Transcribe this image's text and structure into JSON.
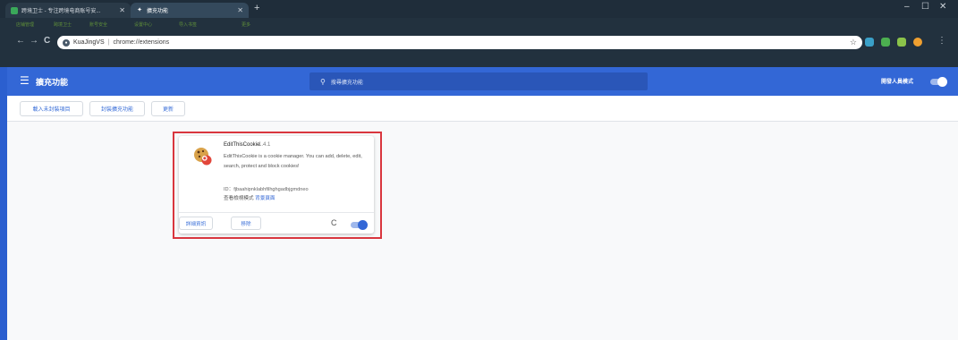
{
  "browser": {
    "tabs": [
      {
        "title": "跨境卫士 - 专注跨境电商账号安...",
        "active": false
      },
      {
        "title": "擴充功能",
        "active": true
      }
    ],
    "new_tab_symbol": "+",
    "window_controls": {
      "minimize": "–",
      "maximize": "☐",
      "close": "✕"
    },
    "bookmarks": [
      "店铺管理",
      "跨境卫士",
      "账号安全",
      "设置中心",
      "导入书签",
      "更多"
    ],
    "address": {
      "site": "KuaJingVS",
      "separator": "|",
      "url": "chrome://extensions"
    }
  },
  "header": {
    "title": "擴充功能",
    "search_placeholder": "搜尋擴充功能",
    "dev_mode_label": "開發人員模式",
    "dev_mode_on": true
  },
  "toolbar": {
    "load_unpacked": "載入未封裝項目",
    "pack_extension": "封裝擴充功能",
    "update": "更新"
  },
  "extension": {
    "name": "EditThisCookie",
    "version": "1.4.1",
    "description": "EditThisCookie is a cookie manager. You can add, delete, edit, search, protect and block cookies!",
    "id_label": "ID：",
    "id": "fjbaahipnklabhfilhghgadbjgmdneo",
    "inspect_label": "查看檢視模式",
    "inspect_link": "背景頁面",
    "details_button": "詳細資訊",
    "remove_button": "移除",
    "enabled": true
  },
  "colors": {
    "header_blue": "#3367d6",
    "highlight_red": "#d9363e",
    "toggle_blue": "#3367d6"
  }
}
